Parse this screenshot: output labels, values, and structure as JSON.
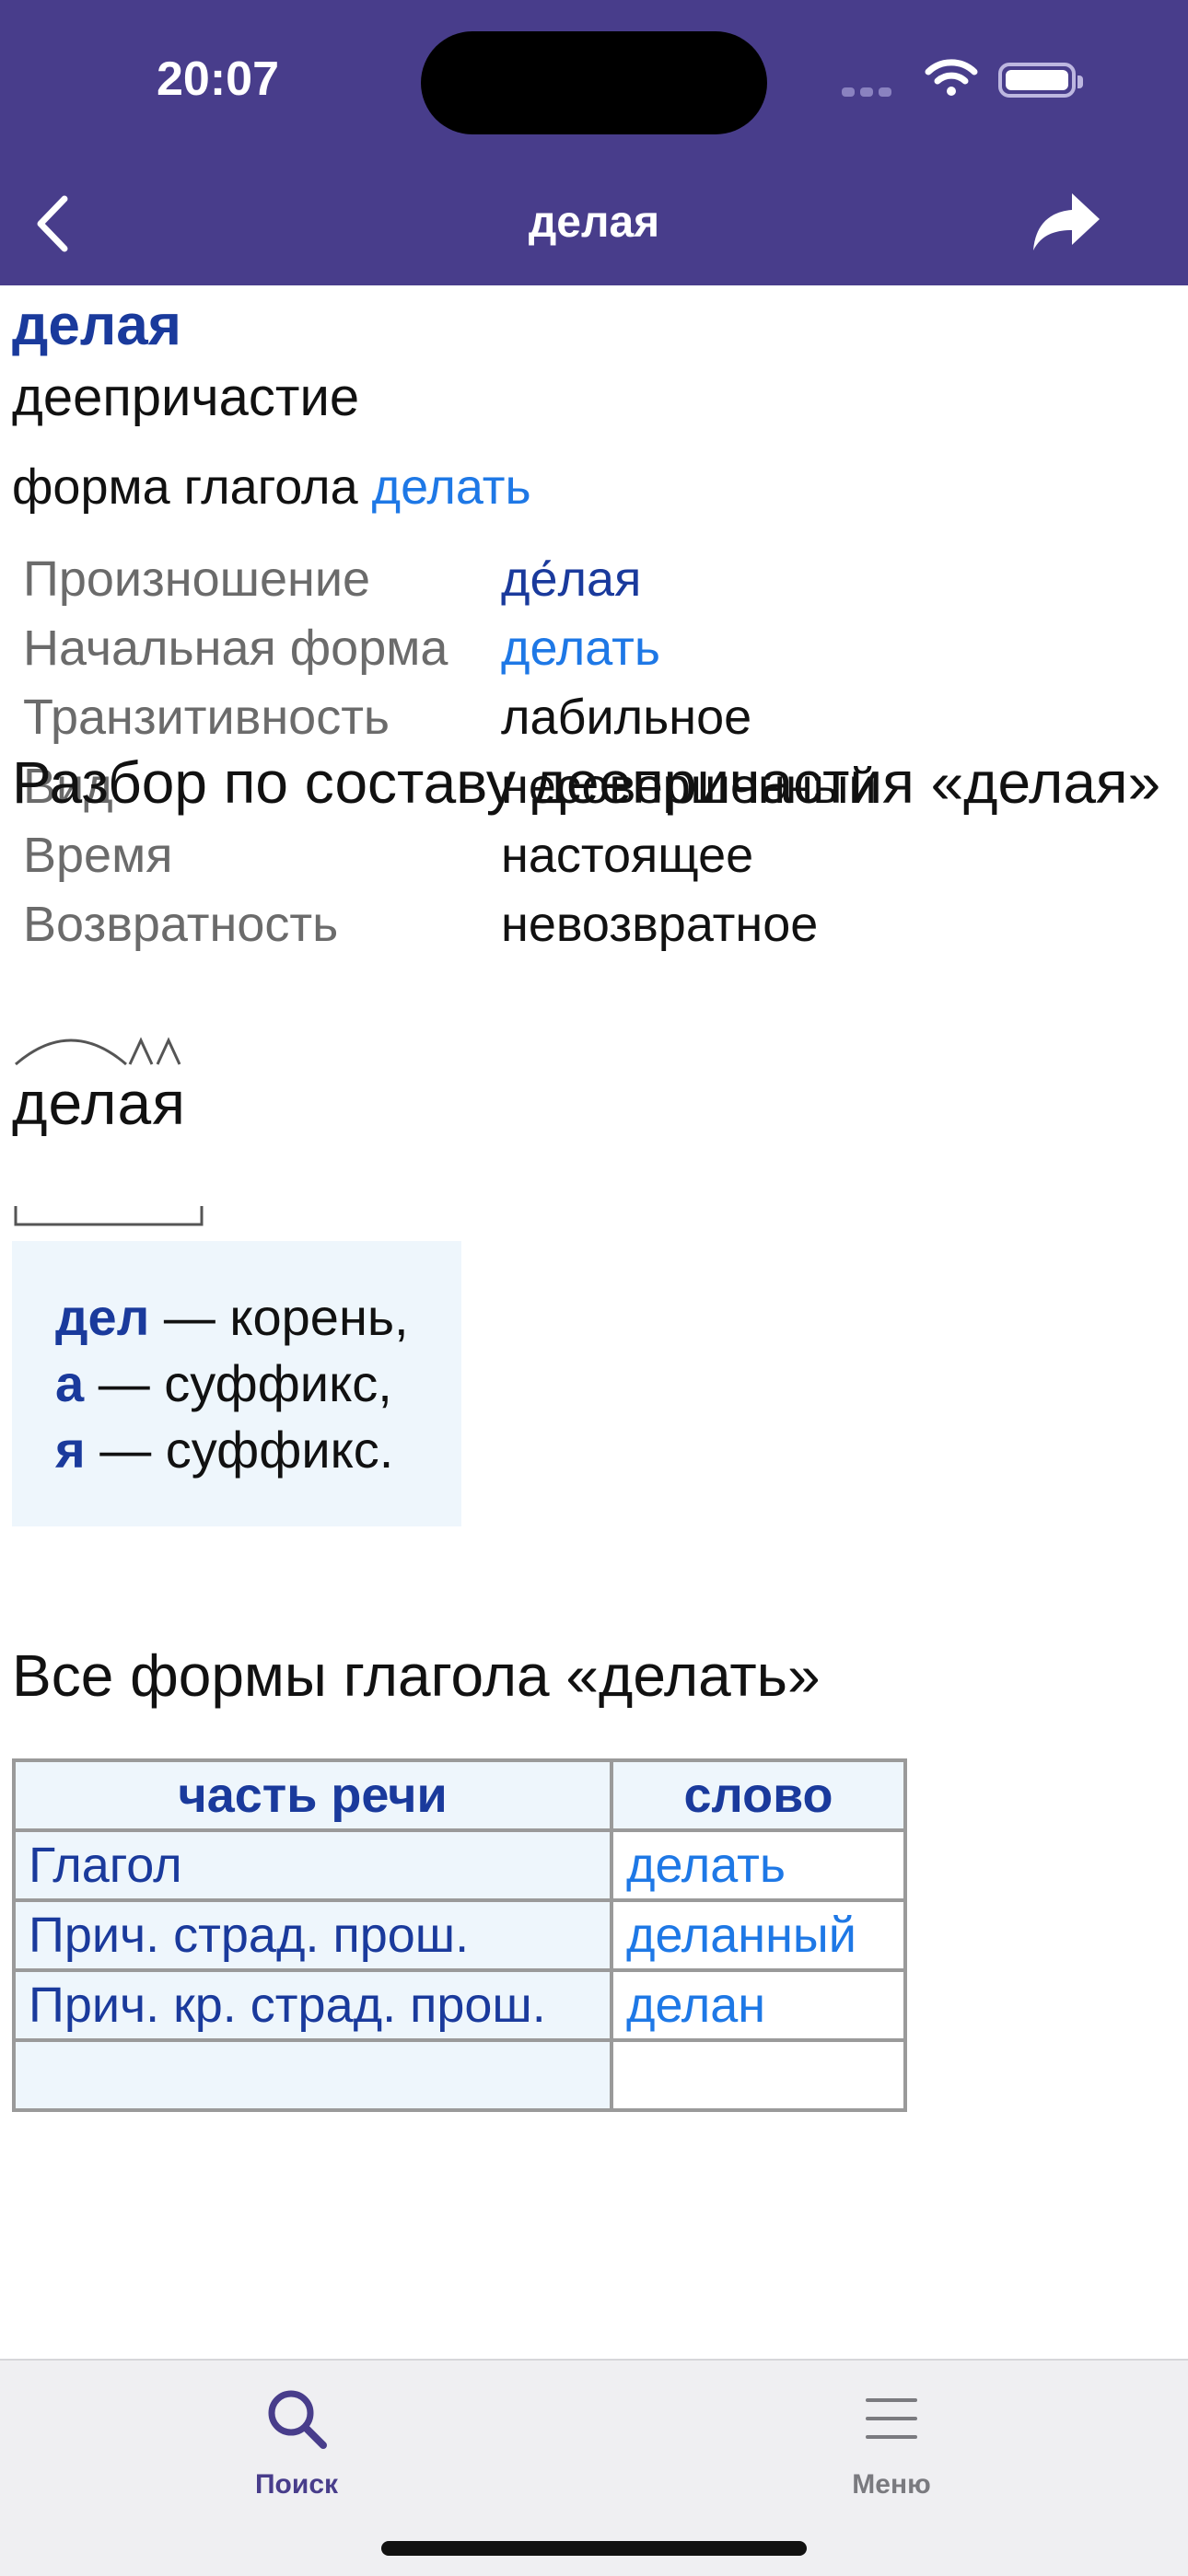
{
  "status": {
    "time": "20:07"
  },
  "nav": {
    "title": "делая"
  },
  "entry": {
    "word": "делая",
    "part_of_speech": "деепричастие",
    "form_of_prefix": "форма глагола",
    "form_of_link": "делать"
  },
  "properties": [
    {
      "label": "Произношение",
      "value": "де́лая"
    },
    {
      "label": "Начальная форма",
      "value": "делать"
    },
    {
      "label": "Транзитивность",
      "value": "лабильное"
    },
    {
      "label": "Вид",
      "value": "несовершенный"
    },
    {
      "label": "Время",
      "value": "настоящее"
    },
    {
      "label": "Возвратность",
      "value": "невозвратное"
    }
  ],
  "morphemes": {
    "heading": "Разбор по составу деепричастия «делая»",
    "word": "делая",
    "parts": [
      {
        "morpheme": "дел",
        "desc": " — корень,"
      },
      {
        "morpheme": "а",
        "desc": " — суффикс,"
      },
      {
        "morpheme": "я",
        "desc": " — суффикс."
      }
    ]
  },
  "forms": {
    "heading": "Все формы глагола «делать»",
    "columns": [
      "часть речи",
      "слово"
    ],
    "rows": [
      [
        "Глагол",
        "делать"
      ],
      [
        "Прич. страд. прош.",
        "деланный"
      ],
      [
        "Прич. кр. страд. прош.",
        "делан"
      ]
    ]
  },
  "tabbar": {
    "search_label": "Поиск",
    "menu_label": "Меню"
  },
  "colors": {
    "brand": "#483d8b",
    "word_accent": "#1a3a9c",
    "link": "#1e78e6",
    "morph_bg": "#eef6fc"
  }
}
